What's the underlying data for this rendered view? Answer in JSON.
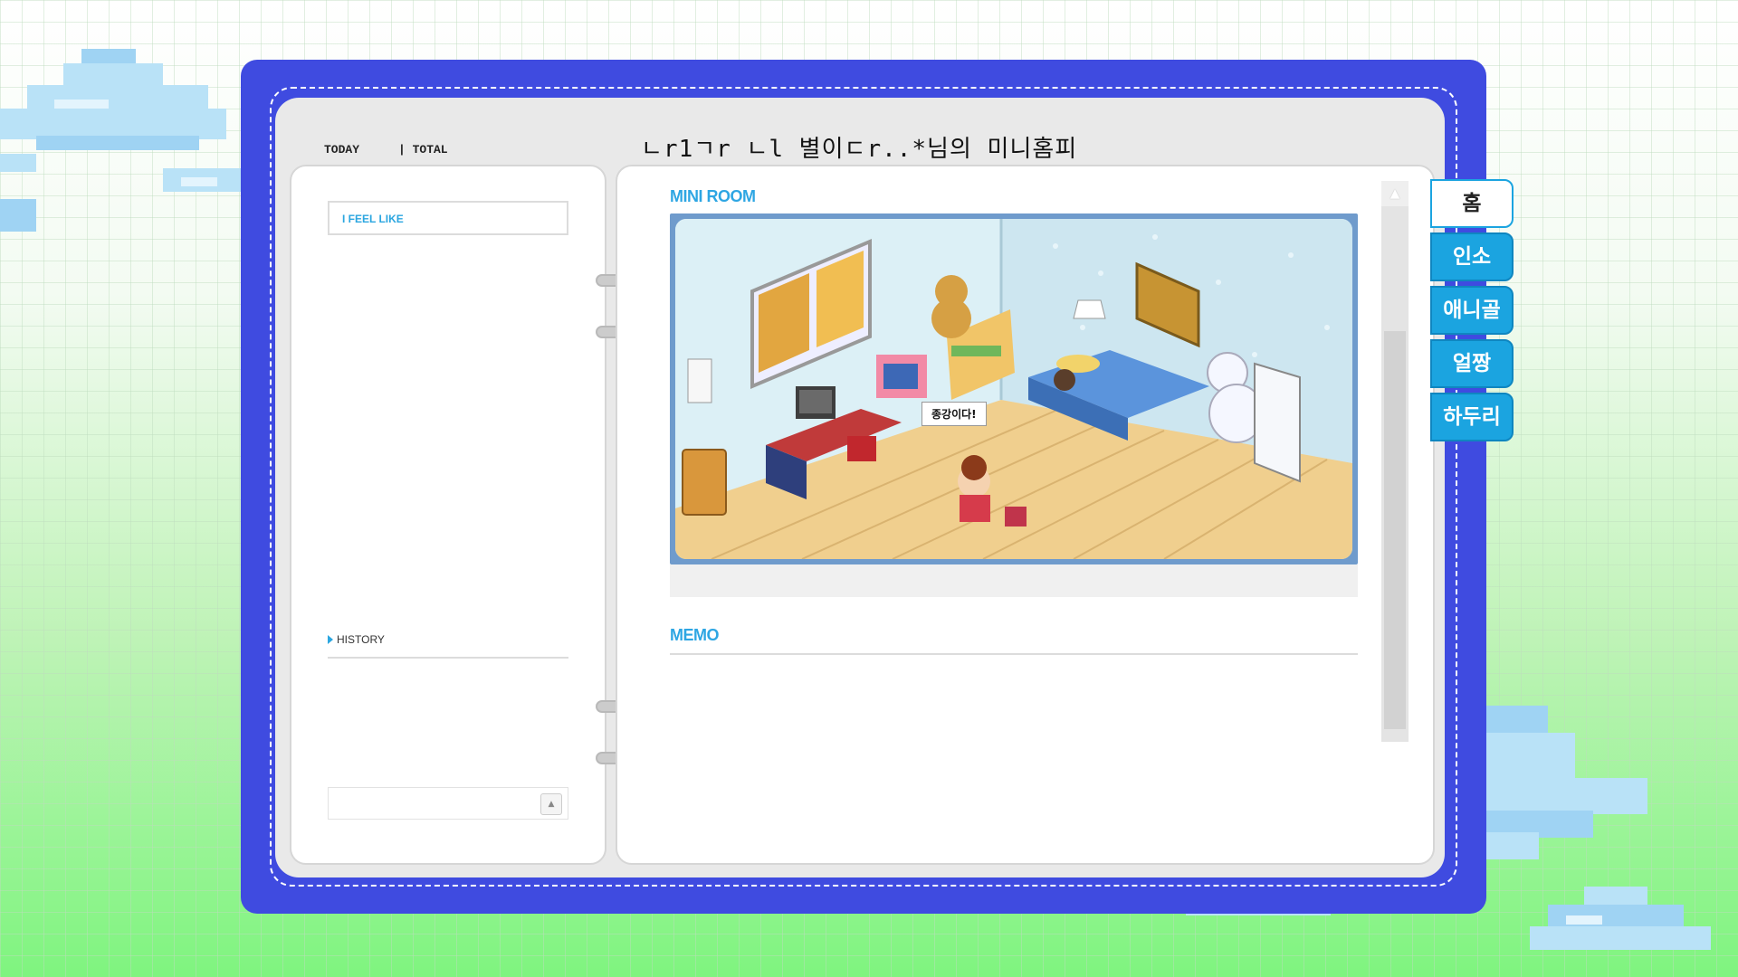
{
  "header": {
    "today_label": "TODAY",
    "total_label": "| TOTAL",
    "site_title": "ㄴr1ㄱr ㄴl 별이ㄷr..*님의 미니홈피"
  },
  "left_page": {
    "feel_label": "I FEEL LIKE",
    "history_label": "HISTORY"
  },
  "right_page": {
    "miniroom_title": "MINI ROOM",
    "memo_title": "MEMO",
    "speech_bubble": "종강이다!"
  },
  "tabs": [
    {
      "label": "홈",
      "active": true
    },
    {
      "label": "인소",
      "active": false
    },
    {
      "label": "애니골",
      "active": false
    },
    {
      "label": "얼짱",
      "active": false
    },
    {
      "label": "하두리",
      "active": false
    }
  ],
  "colors": {
    "book": "#3f4be0",
    "accent": "#2ea6e3",
    "tab": "#1ba4e0"
  }
}
